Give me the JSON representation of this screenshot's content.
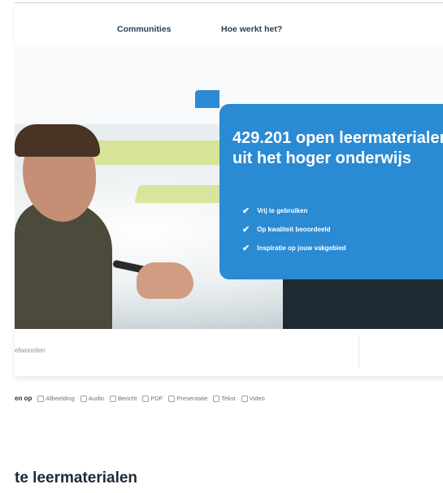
{
  "nav": {
    "communities": "Communities",
    "how_it_works": "Hoe werkt het?"
  },
  "hero": {
    "title": "429.201 open leermaterialen uit het hoger onderwijs",
    "bullets": [
      "Vrij te gebruiken",
      "Op kwaliteit beoordeeld",
      "Inspiratie op jouw vakgebied"
    ],
    "accent_color": "#2a8ad4"
  },
  "search": {
    "placeholder": "efwoorden"
  },
  "filters": {
    "label": "en op",
    "options": [
      "Afbeelding",
      "Audio",
      "Bericht",
      "PDF",
      "Presentatie",
      "Tekst",
      "Video"
    ]
  },
  "section": {
    "title": "te leermaterialen"
  }
}
